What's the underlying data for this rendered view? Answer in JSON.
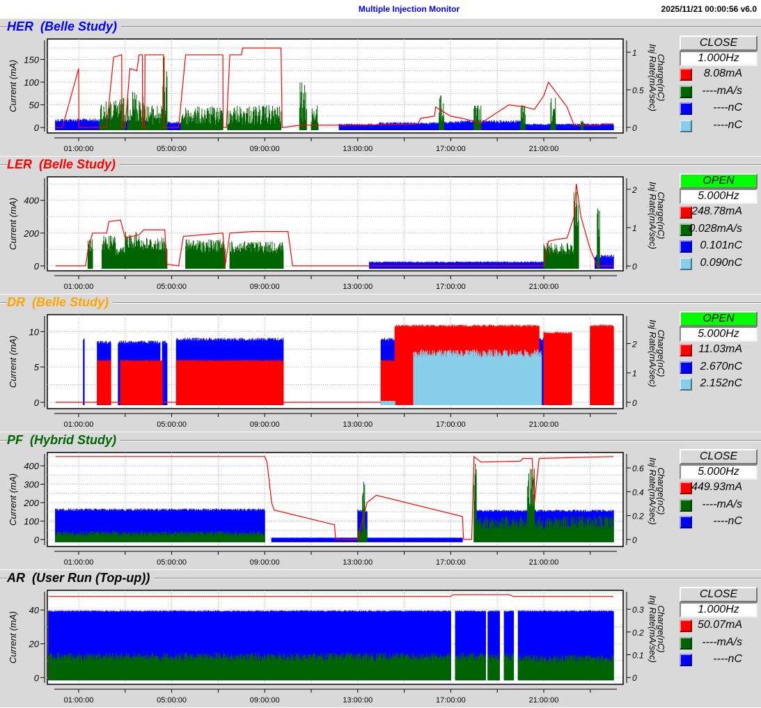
{
  "header": {
    "title": "Multiple Injection Monitor",
    "datetime": "2025/11/21 00:00:56   v6.0"
  },
  "colors": {
    "current": "#ff0000",
    "inj_rate": "#006400",
    "charge": "#0000ff",
    "charge2": "#87ceeb"
  },
  "panels": [
    {
      "name": "HER",
      "mode": "(Belle Study)",
      "title_color": "#0000ff",
      "button": "CLOSE",
      "button_state": "close",
      "rate": "1.000Hz",
      "legend": [
        {
          "color": "#ff0000",
          "value": "8.08mA"
        },
        {
          "color": "#006400",
          "value": "----mA/s"
        },
        {
          "color": "#0000ff",
          "value": "----nC"
        },
        {
          "color": "#87ceeb",
          "value": "----nC"
        }
      ]
    },
    {
      "name": "LER",
      "mode": "(Belle Study)",
      "title_color": "#ff0000",
      "button": "OPEN",
      "button_state": "open",
      "rate": "5.000Hz",
      "legend": [
        {
          "color": "#ff0000",
          "value": "248.78mA"
        },
        {
          "color": "#006400",
          "value": "0.028mA/s"
        },
        {
          "color": "#0000ff",
          "value": "0.101nC"
        },
        {
          "color": "#87ceeb",
          "value": "0.090nC"
        }
      ]
    },
    {
      "name": "DR",
      "mode": "(Belle Study)",
      "title_color": "#ffa500",
      "button": "OPEN",
      "button_state": "open",
      "rate": "5.000Hz",
      "legend": [
        {
          "color": "#ff0000",
          "value": "11.03mA"
        },
        {
          "color": "#0000ff",
          "value": "2.670nC"
        },
        {
          "color": "#87ceeb",
          "value": "2.152nC"
        }
      ]
    },
    {
      "name": "PF",
      "mode": "(Hybrid Study)",
      "title_color": "#006400",
      "button": "CLOSE",
      "button_state": "close",
      "rate": "5.000Hz",
      "legend": [
        {
          "color": "#ff0000",
          "value": "449.93mA"
        },
        {
          "color": "#006400",
          "value": "----mA/s"
        },
        {
          "color": "#0000ff",
          "value": "----nC"
        }
      ]
    },
    {
      "name": "AR",
      "mode": "(User Run (Top-up))",
      "title_color": "#000000",
      "button": "CLOSE",
      "button_state": "close",
      "rate": "1.000Hz",
      "legend": [
        {
          "color": "#ff0000",
          "value": "50.07mA"
        },
        {
          "color": "#006400",
          "value": "----mA/s"
        },
        {
          "color": "#0000ff",
          "value": "----nC"
        }
      ]
    }
  ],
  "chart_data": [
    {
      "type": "line",
      "title": "HER",
      "ylabel": "Current (mA)",
      "y2label": [
        "Charge(nC)",
        "Inj Rate(mA/sec)"
      ],
      "xticks": [
        "01:00:00",
        "05:00:00",
        "09:00:00",
        "13:00:00",
        "17:00:00",
        "21:00:00"
      ],
      "xlim_hours": [
        0,
        24
      ],
      "ylim": [
        -12,
        195
      ],
      "yticks": [
        0,
        50,
        100,
        150
      ],
      "y2lim": [
        -0.074,
        1.176
      ],
      "y2ticks": [
        0,
        0.5,
        1
      ],
      "bands": [
        {
          "series": "charge",
          "axis": "right",
          "color": "#0000ff",
          "noise": 0.4,
          "segments": [
            [
              0,
              2.5,
              0.12
            ],
            [
              2.5,
              4.0,
              0.1
            ],
            [
              4.5,
              5.4,
              0.08
            ],
            [
              12.2,
              13.9,
              0.05
            ],
            [
              13.9,
              16.5,
              0.07
            ],
            [
              16.5,
              17.4,
              0.08
            ],
            [
              17.4,
              20.0,
              0.1
            ],
            [
              20.0,
              24,
              0.05
            ]
          ]
        },
        {
          "series": "inj_rate",
          "axis": "right",
          "color": "#006400",
          "noise": 0.9,
          "segments": [
            [
              1.9,
              2.6,
              0.35
            ],
            [
              2.6,
              3.0,
              0.4
            ],
            [
              3.1,
              3.8,
              0.5
            ],
            [
              3.8,
              4.6,
              0.3
            ],
            [
              4.6,
              4.8,
              0.95
            ],
            [
              5.4,
              7.2,
              0.28
            ],
            [
              7.4,
              9.7,
              0.3
            ],
            [
              10.5,
              10.8,
              0.6
            ],
            [
              11.0,
              11.3,
              0.3
            ],
            [
              16.5,
              16.7,
              0.5
            ],
            [
              18.0,
              18.3,
              0.3
            ],
            [
              20.0,
              20.2,
              0.3
            ],
            [
              21.3,
              21.5,
              0.4
            ],
            [
              22.6,
              22.7,
              0.1
            ]
          ]
        }
      ],
      "current": [
        [
          0,
          0
        ],
        [
          0.3,
          0
        ],
        [
          1.0,
          130
        ],
        [
          1.01,
          0
        ],
        [
          2.2,
          0
        ],
        [
          2.5,
          155
        ],
        [
          2.85,
          160
        ],
        [
          2.86,
          0
        ],
        [
          3.0,
          0
        ],
        [
          3.2,
          130
        ],
        [
          3.5,
          125
        ],
        [
          3.6,
          160
        ],
        [
          3.74,
          160
        ],
        [
          3.75,
          0
        ],
        [
          3.84,
          0
        ],
        [
          3.85,
          160
        ],
        [
          4.65,
          160
        ],
        [
          4.66,
          0
        ],
        [
          5.3,
          0
        ],
        [
          5.6,
          160
        ],
        [
          7.2,
          160
        ],
        [
          7.21,
          0
        ],
        [
          7.35,
          0
        ],
        [
          7.5,
          160
        ],
        [
          8.0,
          160
        ],
        [
          8.05,
          175
        ],
        [
          9.7,
          175
        ],
        [
          9.75,
          0
        ],
        [
          10.5,
          5
        ],
        [
          13.0,
          5
        ],
        [
          15.6,
          8
        ],
        [
          15.7,
          20
        ],
        [
          16.3,
          25
        ],
        [
          16.35,
          45
        ],
        [
          17.0,
          25
        ],
        [
          17.5,
          20
        ],
        [
          18.3,
          10
        ],
        [
          19.5,
          50
        ],
        [
          20.2,
          45
        ],
        [
          20.6,
          40
        ],
        [
          21.0,
          70
        ],
        [
          21.2,
          100
        ],
        [
          22.0,
          45
        ],
        [
          22.3,
          5
        ],
        [
          23.4,
          5
        ],
        [
          23.5,
          8
        ],
        [
          24,
          8
        ]
      ]
    },
    {
      "type": "line",
      "title": "LER",
      "ylabel": "Current (mA)",
      "y2label": [
        "Charge(nC)",
        "Inj Rate(mA/sec)"
      ],
      "xticks": [
        "01:00:00",
        "05:00:00",
        "09:00:00",
        "13:00:00",
        "17:00:00",
        "21:00:00"
      ],
      "xlim_hours": [
        0,
        24
      ],
      "ylim": [
        -30,
        543
      ],
      "yticks": [
        0,
        200,
        400
      ],
      "y2lim": [
        -0.126,
        2.324
      ],
      "y2ticks": [
        0,
        1,
        2
      ],
      "bands": [
        {
          "series": "charge",
          "axis": "right",
          "color": "#0000ff",
          "noise": 0.3,
          "segments": [
            [
              1.4,
              1.5,
              0.2
            ],
            [
              13.5,
              21.4,
              0.12
            ],
            [
              23.2,
              24,
              0.3
            ]
          ]
        },
        {
          "series": "inj_rate",
          "axis": "right",
          "color": "#006400",
          "noise": 0.5,
          "segments": [
            [
              1.4,
              1.6,
              0.7
            ],
            [
              2.0,
              2.6,
              0.8
            ],
            [
              2.6,
              3.0,
              0.5
            ],
            [
              3.0,
              3.7,
              0.9
            ],
            [
              3.7,
              4.8,
              0.75
            ],
            [
              5.6,
              7.3,
              0.7
            ],
            [
              7.5,
              9.8,
              0.65
            ],
            [
              21.0,
              22.3,
              0.6
            ],
            [
              22.3,
              22.5,
              2.0
            ],
            [
              23.3,
              23.4,
              1.5
            ]
          ]
        }
      ],
      "current": [
        [
          0,
          0
        ],
        [
          1.3,
          0
        ],
        [
          1.4,
          100
        ],
        [
          1.6,
          200
        ],
        [
          2.2,
          200
        ],
        [
          2.3,
          270
        ],
        [
          2.8,
          280
        ],
        [
          3.0,
          170
        ],
        [
          3.6,
          190
        ],
        [
          3.8,
          220
        ],
        [
          4.7,
          220
        ],
        [
          4.8,
          10
        ],
        [
          5.3,
          0
        ],
        [
          5.5,
          180
        ],
        [
          7.2,
          200
        ],
        [
          7.3,
          0
        ],
        [
          7.5,
          200
        ],
        [
          8.5,
          210
        ],
        [
          10.0,
          210
        ],
        [
          10.2,
          0
        ],
        [
          21.0,
          0
        ],
        [
          21.2,
          150
        ],
        [
          21.5,
          160
        ],
        [
          22.0,
          170
        ],
        [
          22.3,
          300
        ],
        [
          22.4,
          500
        ],
        [
          22.6,
          300
        ],
        [
          23.0,
          100
        ],
        [
          23.3,
          0
        ],
        [
          24,
          0
        ]
      ]
    },
    {
      "type": "line",
      "title": "DR",
      "ylabel": "Current (mA)",
      "y2label": [
        "Charge(nC)",
        "Inj Rate(mA/sec)"
      ],
      "xticks": [
        "01:00:00",
        "05:00:00",
        "09:00:00",
        "13:00:00",
        "17:00:00",
        "21:00:00"
      ],
      "xlim_hours": [
        0,
        24
      ],
      "ylim": [
        -0.9,
        12.4
      ],
      "yticks": [
        0,
        5,
        10
      ],
      "y2lim": [
        -0.214,
        2.98
      ],
      "y2ticks": [
        0,
        1,
        2
      ],
      "bands": [
        {
          "series": "charge",
          "axis": "right",
          "color": "#0000ff",
          "noise": 0.05,
          "segments": [
            [
              1.2,
              1.25,
              2.2
            ],
            [
              1.8,
              2.4,
              2.1
            ],
            [
              2.7,
              4.5,
              2.1
            ],
            [
              4.6,
              4.8,
              2.1
            ],
            [
              5.2,
              9.8,
              2.2
            ],
            [
              14.0,
              14.6,
              2.2
            ],
            [
              15.4,
              17.8,
              2.3
            ],
            [
              18.0,
              21.0,
              2.2
            ],
            [
              21.2,
              21.9,
              2.2
            ],
            [
              23.0,
              24,
              2.2
            ]
          ]
        },
        {
          "series": "current",
          "axis": "left",
          "color": "#ff0000",
          "noise": 0.03,
          "segments": [
            [
              1.8,
              2.4,
              6
            ],
            [
              2.8,
              4.6,
              6
            ],
            [
              5.2,
              9.8,
              6
            ],
            [
              14.0,
              14.6,
              6
            ],
            [
              14.6,
              20.8,
              11
            ],
            [
              21.0,
              22.2,
              10
            ],
            [
              23.0,
              24,
              11
            ]
          ]
        },
        {
          "series": "charge2",
          "axis": "right",
          "color": "#87ceeb",
          "noise": 0.15,
          "segments": [
            [
              14.0,
              14.6,
              0.05
            ],
            [
              15.4,
              20.9,
              1.8
            ]
          ]
        }
      ],
      "current": [
        [
          0,
          0
        ],
        [
          1.2,
          0
        ],
        [
          14.0,
          0
        ]
      ]
    },
    {
      "type": "line",
      "title": "PF",
      "ylabel": "Current (mA)",
      "y2label": [
        "Charge(nC)",
        "Inj Rate(mA/sec)"
      ],
      "xticks": [
        "01:00:00",
        "05:00:00",
        "09:00:00",
        "13:00:00",
        "17:00:00",
        "21:00:00"
      ],
      "xlim_hours": [
        0,
        24
      ],
      "ylim": [
        -38,
        472
      ],
      "yticks": [
        0,
        100,
        200,
        300,
        400
      ],
      "y2lim": [
        -0.059,
        0.729
      ],
      "y2ticks": [
        0,
        0.2,
        0.4,
        0.6
      ],
      "bands": [
        {
          "series": "charge",
          "axis": "right",
          "color": "#0000ff",
          "noise": 0.08,
          "segments": [
            [
              0,
              9.0,
              0.26
            ],
            [
              9.3,
              17.5,
              0.015
            ],
            [
              13.0,
              13.4,
              0.25
            ],
            [
              18.0,
              24,
              0.25
            ]
          ]
        },
        {
          "series": "inj_rate",
          "axis": "right",
          "color": "#006400",
          "noise": 0.6,
          "segments": [
            [
              0,
              9.0,
              0.07
            ],
            [
              13.0,
              13.4,
              0.1
            ],
            [
              13.2,
              13.3,
              0.5
            ],
            [
              18.0,
              24,
              0.2
            ],
            [
              18.0,
              18.1,
              0.65
            ],
            [
              20.3,
              20.6,
              0.6
            ]
          ]
        }
      ],
      "current": [
        [
          0,
          450
        ],
        [
          9.0,
          450
        ],
        [
          9.1,
          420
        ],
        [
          9.3,
          200
        ],
        [
          9.4,
          160
        ],
        [
          12.0,
          80
        ],
        [
          12.05,
          0
        ],
        [
          13.0,
          0
        ],
        [
          13.2,
          100
        ],
        [
          13.4,
          200
        ],
        [
          13.8,
          240
        ],
        [
          17.5,
          125
        ],
        [
          17.55,
          0
        ],
        [
          17.9,
          0
        ],
        [
          18.0,
          450
        ],
        [
          18.3,
          420
        ],
        [
          20.0,
          425
        ],
        [
          20.1,
          440
        ],
        [
          20.5,
          440
        ],
        [
          20.6,
          200
        ],
        [
          20.8,
          440
        ],
        [
          24,
          450
        ]
      ]
    },
    {
      "type": "line",
      "title": "AR",
      "ylabel": "Current (mA)",
      "y2label": [
        "Charge(nC)",
        "Inj Rate(mA/sec)"
      ],
      "xticks": [
        "01:00:00",
        "05:00:00",
        "09:00:00",
        "13:00:00",
        "17:00:00",
        "21:00:00"
      ],
      "xlim_hours": [
        0,
        24
      ],
      "ylim": [
        -4,
        51.6
      ],
      "yticks": [
        0,
        20,
        40
      ],
      "y2lim": [
        -0.03,
        0.383
      ],
      "y2ticks": [
        0,
        0.1,
        0.2,
        0.3
      ],
      "bands": [
        {
          "series": "charge",
          "axis": "right",
          "color": "#0000ff",
          "noise": 0.02,
          "segments": [
            [
              -0.3,
              17.0,
              0.295
            ],
            [
              17.2,
              18.5,
              0.295
            ],
            [
              18.6,
              19.1,
              0.295
            ],
            [
              19.3,
              19.7,
              0.295
            ],
            [
              19.9,
              24,
              0.295
            ]
          ]
        },
        {
          "series": "inj_rate",
          "axis": "right",
          "color": "#006400",
          "noise": 0.35,
          "segments": [
            [
              -0.3,
              17.0,
              0.11
            ],
            [
              17.2,
              18.5,
              0.11
            ],
            [
              18.6,
              19.1,
              0.11
            ],
            [
              19.3,
              19.7,
              0.11
            ],
            [
              19.9,
              24,
              0.1
            ]
          ]
        }
      ],
      "current": [
        [
          -0.3,
          48
        ],
        [
          17.0,
          48
        ],
        [
          17.1,
          49
        ],
        [
          19.5,
          49
        ],
        [
          19.7,
          48
        ],
        [
          24,
          48
        ]
      ]
    }
  ]
}
